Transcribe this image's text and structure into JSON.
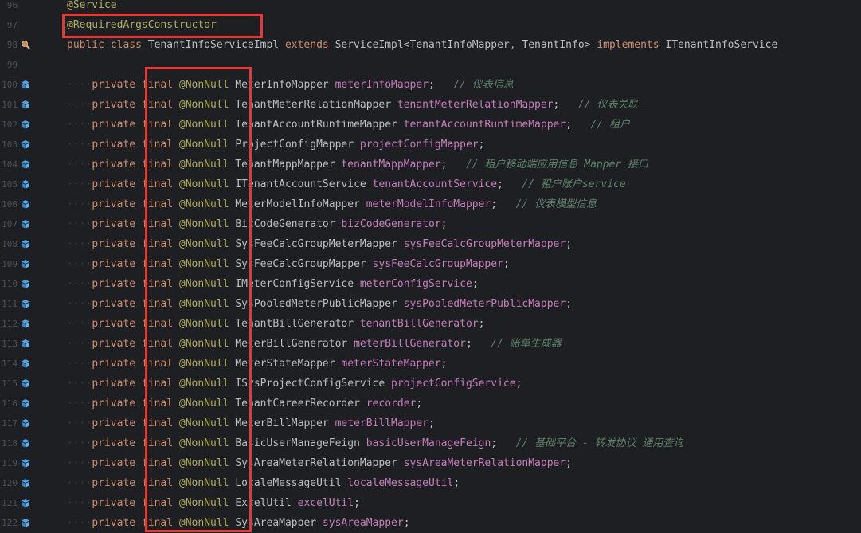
{
  "editor": {
    "accent_color": "#e53935",
    "lines": [
      {
        "num": "96",
        "icon": "",
        "parts": [
          {
            "t": "@Service",
            "c": "ann"
          }
        ]
      },
      {
        "num": "97",
        "icon": "",
        "parts": [
          {
            "t": "@RequiredArgsConstructor",
            "c": "ann"
          }
        ]
      },
      {
        "num": "98",
        "icon": "bean-search-icon",
        "parts": [
          {
            "t": "public ",
            "c": "kw"
          },
          {
            "t": "class ",
            "c": "kw"
          },
          {
            "t": "TenantInfoServiceImpl ",
            "c": "ty"
          },
          {
            "t": "extends ",
            "c": "kw"
          },
          {
            "t": "ServiceImpl<TenantInfoMapper",
            "c": "ty"
          },
          {
            "t": ", ",
            "c": "kw"
          },
          {
            "t": "TenantInfo> ",
            "c": "ty"
          },
          {
            "t": "implements ",
            "c": "kw"
          },
          {
            "t": "ITenantInfoService",
            "c": "ty"
          }
        ]
      },
      {
        "num": "99",
        "icon": "",
        "parts": []
      },
      {
        "num": "100",
        "icon": "bean-icon",
        "field": [
          "MeterInfoMapper ",
          "meterInfoMapper",
          ";",
          "// 仪表信息"
        ]
      },
      {
        "num": "101",
        "icon": "bean-icon",
        "field": [
          "TenantMeterRelationMapper ",
          "tenantMeterRelationMapper",
          ";",
          "// 仪表关联"
        ]
      },
      {
        "num": "102",
        "icon": "bean-icon",
        "field": [
          "TenantAccountRuntimeMapper ",
          "tenantAccountRuntimeMapper",
          ";",
          "// 租户"
        ]
      },
      {
        "num": "103",
        "icon": "bean-icon",
        "field": [
          "ProjectConfigMapper ",
          "projectConfigMapper",
          ";",
          ""
        ]
      },
      {
        "num": "104",
        "icon": "bean-icon",
        "field": [
          "TenantMappMapper ",
          "tenantMappMapper",
          ";",
          "// 租户移动端应用信息 Mapper 接口"
        ]
      },
      {
        "num": "105",
        "icon": "bean-icon",
        "field": [
          "ITenantAccountService ",
          "tenantAccountService",
          ";",
          "// 租户账户service"
        ]
      },
      {
        "num": "106",
        "icon": "bean-icon",
        "field": [
          "MeterModelInfoMapper ",
          "meterModelInfoMapper",
          ";",
          "// 仪表模型信息"
        ]
      },
      {
        "num": "107",
        "icon": "bean-icon",
        "field": [
          "BizCodeGenerator ",
          "bizCodeGenerator",
          ";",
          ""
        ]
      },
      {
        "num": "108",
        "icon": "bean-icon",
        "field": [
          "SysFeeCalcGroupMeterMapper ",
          "sysFeeCalcGroupMeterMapper",
          ";",
          ""
        ]
      },
      {
        "num": "109",
        "icon": "bean-icon",
        "field": [
          "SysFeeCalcGroupMapper ",
          "sysFeeCalcGroupMapper",
          ";",
          ""
        ]
      },
      {
        "num": "110",
        "icon": "bean-icon",
        "field": [
          "IMeterConfigService ",
          "meterConfigService",
          ";",
          ""
        ]
      },
      {
        "num": "111",
        "icon": "bean-icon",
        "field": [
          "SysPooledMeterPublicMapper ",
          "sysPooledMeterPublicMapper",
          ";",
          ""
        ]
      },
      {
        "num": "112",
        "icon": "bean-icon",
        "field": [
          "TenantBillGenerator ",
          "tenantBillGenerator",
          ";",
          ""
        ]
      },
      {
        "num": "113",
        "icon": "bean-icon",
        "field": [
          "MeterBillGenerator ",
          "meterBillGenerator",
          ";",
          "// 账单生成器"
        ]
      },
      {
        "num": "114",
        "icon": "bean-icon",
        "field": [
          "MeterStateMapper ",
          "meterStateMapper",
          ";",
          ""
        ]
      },
      {
        "num": "115",
        "icon": "bean-icon",
        "field": [
          "ISysProjectConfigService ",
          "projectConfigService",
          ";",
          ""
        ]
      },
      {
        "num": "116",
        "icon": "bean-icon",
        "field": [
          "TenantCareerRecorder ",
          "recorder",
          ";",
          ""
        ]
      },
      {
        "num": "117",
        "icon": "bean-icon",
        "field": [
          "MeterBillMapper ",
          "meterBillMapper",
          ";",
          ""
        ]
      },
      {
        "num": "118",
        "icon": "bean-icon",
        "field": [
          "BasicUserManageFeign ",
          "basicUserManageFeign",
          ";",
          "// 基础平台 - 转发协议 通用查询"
        ]
      },
      {
        "num": "119",
        "icon": "bean-icon",
        "field": [
          "SysAreaMeterRelationMapper ",
          "sysAreaMeterRelationMapper",
          ";",
          ""
        ]
      },
      {
        "num": "120",
        "icon": "bean-icon",
        "field": [
          "LocaleMessageUtil ",
          "localeMessageUtil",
          ";",
          ""
        ]
      },
      {
        "num": "121",
        "icon": "bean-icon",
        "field": [
          "ExcelUtil ",
          "excelUtil",
          ";",
          ""
        ]
      },
      {
        "num": "122",
        "icon": "bean-icon",
        "field": [
          "SysAreaMapper ",
          "sysAreaMapper",
          ";",
          ""
        ]
      }
    ],
    "field_prefix": {
      "indent": "····",
      "private": "private ",
      "final": "final ",
      "annotation": "@NonNull "
    }
  }
}
